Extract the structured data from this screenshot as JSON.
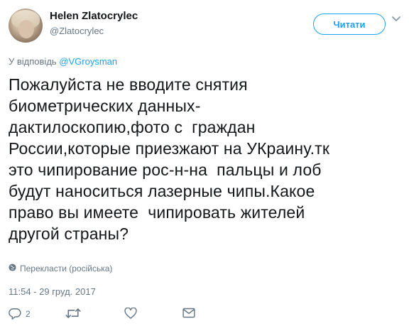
{
  "author": {
    "name": "Helen Zlatocrylec",
    "handle": "@Zlatocrylec"
  },
  "follow_label": "Читати",
  "reply_to": {
    "prefix": "У відповідь ",
    "mention": "@VGroysman"
  },
  "tweet_text": "Пожалуйста не вводите снятия\nбиометрических данных-\nдактилоскопию,фото с  граждан\nРоссии,которые приезжают на УКраину.тк\nэто чипирование рос-н-на  пальцы и лоб\nбудут наноситься лазерные чипы.Какое\nправо вы имеете  чипировать жителей\nдругой страны?",
  "translate_label": "Перекласти (російська)",
  "timestamp": "11:54 - 29 груд. 2017",
  "actions": {
    "reply_count": "2",
    "retweet_count": "",
    "like_count": ""
  },
  "colors": {
    "accent": "#1da1f2",
    "muted": "#657786",
    "text": "#14171a"
  },
  "icons": [
    "chevron-down-icon",
    "globe-icon",
    "reply-icon",
    "retweet-icon",
    "like-icon",
    "message-icon"
  ]
}
